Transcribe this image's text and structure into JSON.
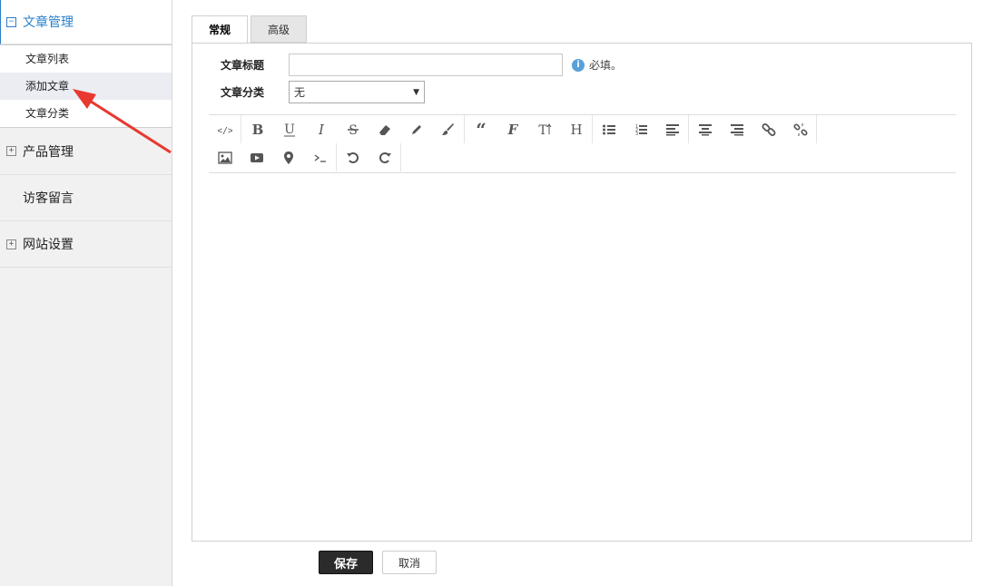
{
  "sidebar": {
    "article_mgmt": {
      "label": "文章管理",
      "toggle": "−"
    },
    "sub_items": [
      "文章列表",
      "添加文章",
      "文章分类"
    ],
    "product_mgmt": {
      "label": "产品管理",
      "toggle": "+"
    },
    "visitor_msg": {
      "label": "访客留言"
    },
    "site_settings": {
      "label": "网站设置",
      "toggle": "+"
    }
  },
  "tabs": {
    "general": "常规",
    "advanced": "高级"
  },
  "form": {
    "title_label": "文章标题",
    "title_value": "",
    "required_hint": "必填。",
    "category_label": "文章分类",
    "category_selected": "无"
  },
  "toolbar_icons": {
    "row1": [
      [
        "code-icon",
        "source"
      ],
      [
        "bold-icon",
        "bold"
      ],
      [
        "underline-icon",
        "underline"
      ],
      [
        "italic-icon",
        "italic"
      ],
      [
        "strikethrough-icon",
        "strike"
      ],
      [
        "eraser-icon",
        "eraser"
      ],
      [
        "pencil-icon",
        "pencil"
      ],
      [
        "brush-icon",
        "brush"
      ],
      [
        "quote-icon",
        "quote"
      ],
      [
        "font-icon",
        "font"
      ],
      [
        "font-size-icon",
        "fontsize"
      ],
      [
        "heading-icon",
        "heading"
      ],
      [
        "bullet-list-icon",
        "ul"
      ],
      [
        "numbered-list-icon",
        "ol"
      ],
      [
        "align-left-icon",
        "left"
      ],
      [
        "align-center-icon",
        "center"
      ],
      [
        "align-right-icon",
        "right"
      ],
      [
        "link-icon",
        "link"
      ],
      [
        "unlink-icon",
        "unlink"
      ],
      [
        "table-icon",
        "table"
      ],
      [
        "emoji-icon",
        "emoji"
      ]
    ],
    "row2": [
      [
        "image-icon",
        "image"
      ],
      [
        "video-icon",
        "video"
      ],
      [
        "map-pin-icon",
        "pin"
      ],
      [
        "terminal-icon",
        "terminal"
      ],
      [
        "undo-icon",
        "undo"
      ],
      [
        "redo-icon",
        "redo"
      ]
    ]
  },
  "buttons": {
    "save": "保存",
    "cancel": "取消"
  },
  "colors": {
    "accent": "#2a7fc9",
    "arrow": "#e8382f",
    "save_bg": "#2b2b2b"
  }
}
